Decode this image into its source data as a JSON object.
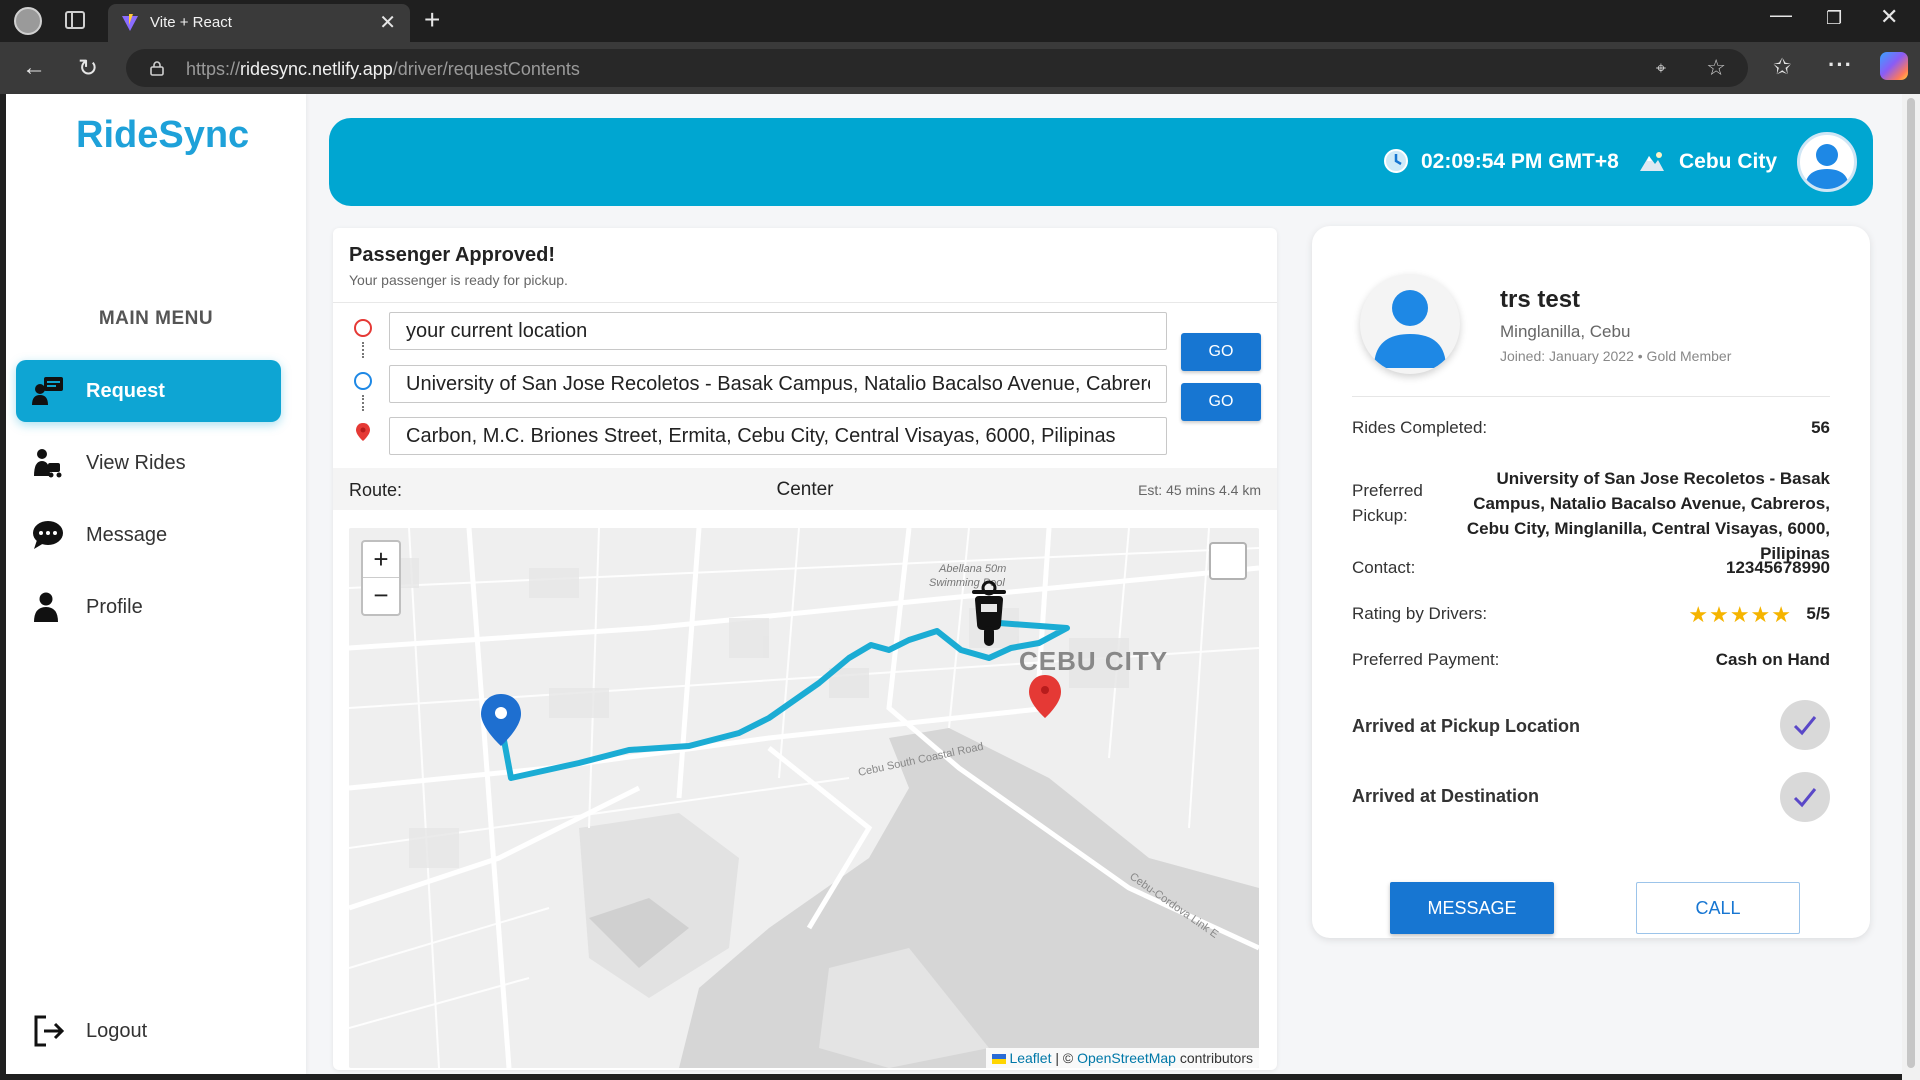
{
  "browser": {
    "tab_title": "Vite + React",
    "url_scheme": "https://",
    "url_host": "ridesync.netlify.app",
    "url_path": "/driver/requestContents"
  },
  "sidebar": {
    "logo": "RideSync",
    "menu_title": "MAIN MENU",
    "items": [
      {
        "label": "Request",
        "icon": "request-icon",
        "active": true
      },
      {
        "label": "View Rides",
        "icon": "view-rides-icon",
        "active": false
      },
      {
        "label": "Message",
        "icon": "message-icon",
        "active": false
      },
      {
        "label": "Profile",
        "icon": "profile-icon",
        "active": false
      }
    ],
    "logout": "Logout"
  },
  "header": {
    "time": "02:09:54 PM GMT+8",
    "city": "Cebu City",
    "accent": "#00a6d1"
  },
  "ride": {
    "status_title": "Passenger Approved!",
    "status_sub": "Your passenger is ready for pickup.",
    "current_location": "your current location",
    "pickup": "University of San Jose Recoletos - Basak Campus, Natalio Bacalso Avenue, Cabreros, Cebu City, Minglanilla, Central Visayas, 6000, Pilipinas",
    "destination": "Carbon, M.C. Briones Street, Ermita, Cebu City, Central Visayas, 6000, Pilipinas",
    "go_label": "GO",
    "route_label": "Route:",
    "route_center": "Center",
    "estimate": "Est: 45 mins   4.4 km"
  },
  "map": {
    "zoom_in": "+",
    "zoom_out": "−",
    "labels": {
      "pool": "Abellana 50m",
      "pool2": "Swimming Pool",
      "city": "CEBU CITY",
      "coastal": "Cebu South Coastal Road",
      "link": "Cebu-Cordova Link E"
    },
    "attrib_leaflet": "Leaflet",
    "attrib_sep": " | © ",
    "attrib_osm": "OpenStreetMap",
    "attrib_tail": " contributors"
  },
  "passenger": {
    "name": "trs test",
    "location": "Minglanilla, Cebu",
    "joined": "Joined: January 2022 • Gold Member",
    "rides_label": "Rides Completed:",
    "rides_value": "56",
    "pickup_label": "Preferred Pickup:",
    "pickup_value": "University of San Jose Recoletos - Basak Campus, Natalio Bacalso Avenue, Cabreros, Cebu City, Minglanilla, Central Visayas, 6000, Pilipinas",
    "contact_label": "Contact:",
    "contact_value": "12345678990",
    "rating_label": "Rating by Drivers:",
    "rating_stars": "★★★★★",
    "rating_value": "5/5",
    "payment_label": "Preferred Payment:",
    "payment_value": "Cash on Hand",
    "arrived_pickup": "Arrived at Pickup Location",
    "arrived_destination": "Arrived at Destination",
    "message_btn": "MESSAGE",
    "call_btn": "CALL"
  }
}
